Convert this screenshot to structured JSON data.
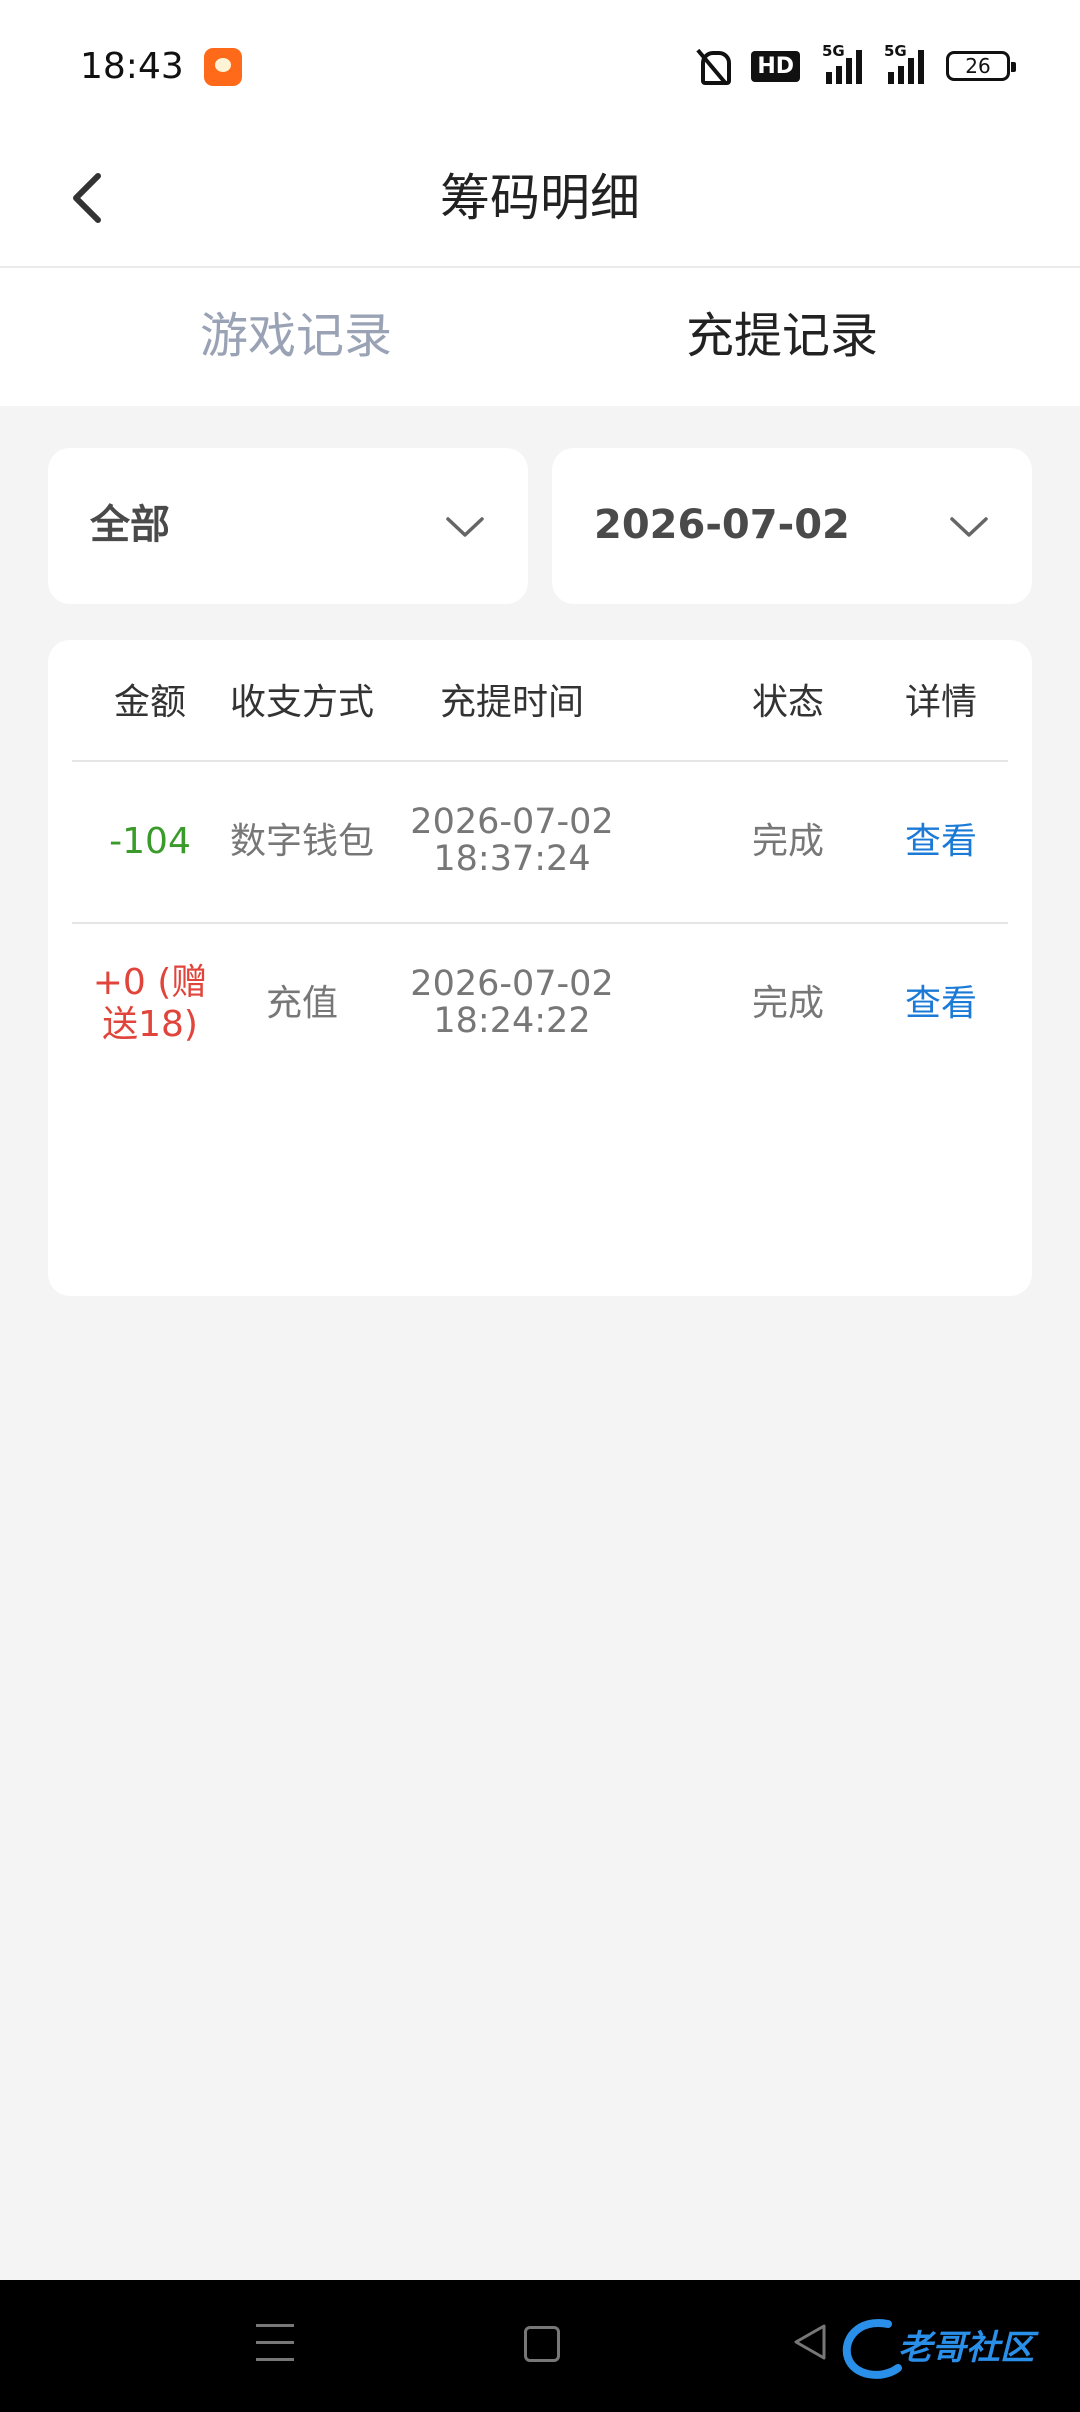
{
  "status_bar": {
    "time": "18:43",
    "hd_label": "HD",
    "signal_label_1": "5G",
    "signal_label_2": "5G",
    "battery": "26"
  },
  "header": {
    "title": "筹码明细"
  },
  "tabs": {
    "game_records": "游戏记录",
    "deposit_withdraw_records": "充提记录",
    "active": "充提记录"
  },
  "filters": {
    "type_value": "全部",
    "date_value": "2026-07-02"
  },
  "table": {
    "columns": [
      "金额",
      "收支方式",
      "充提时间",
      "状态",
      "详情"
    ],
    "rows": [
      {
        "amount_line1": "-104",
        "amount_line2": "",
        "method": "数字钱包",
        "date": "2026-07-02",
        "time": "18:37:24",
        "status": "完成",
        "detail": "查看"
      },
      {
        "amount_line1": "+0 (赠",
        "amount_line2": "送18)",
        "method": "充值",
        "date": "2026-07-02",
        "time": "18:24:22",
        "status": "完成",
        "detail": "查看"
      }
    ]
  },
  "colors": {
    "negative_amount": "#3a9a2a",
    "positive_amount": "#e0443a",
    "link": "#1a7ad6",
    "inactive_tab": "#9aa3b5"
  },
  "watermark": {
    "text": "老哥社区"
  }
}
